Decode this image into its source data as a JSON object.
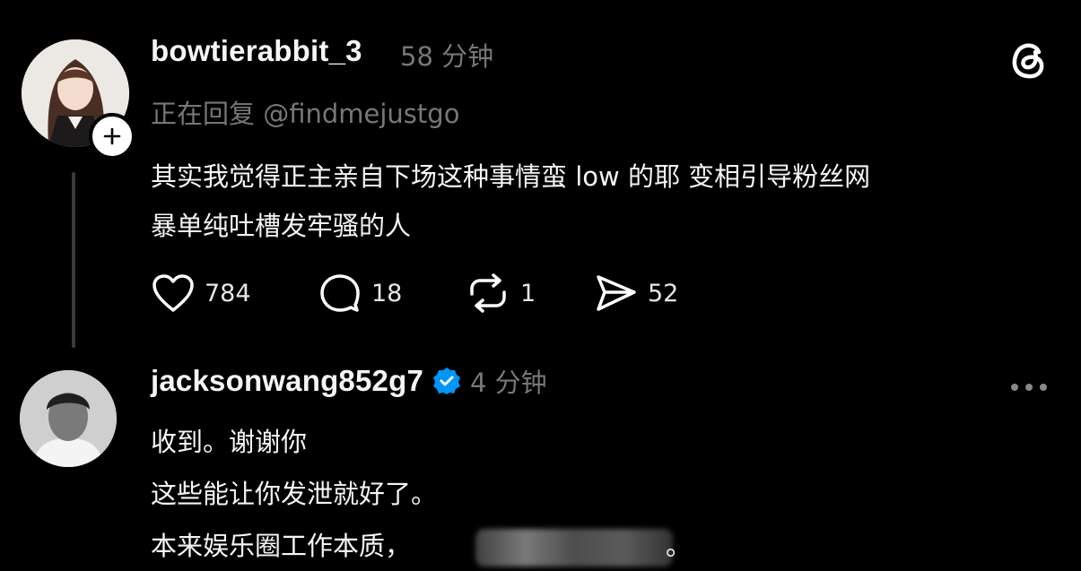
{
  "header": {
    "app_logo_icon": "threads-logo-icon"
  },
  "post": {
    "username": "bowtierabbit_3",
    "time": "58 分钟",
    "reply_to": "正在回复 @findmejustgo",
    "text_lines": [
      "其实我觉得正主亲自下场这种事情蛮 low 的耶 变相引导粉丝网",
      "暴单纯吐槽发牢骚的人"
    ],
    "actions": {
      "likes": "784",
      "comments": "18",
      "reposts": "1",
      "shares": "52"
    }
  },
  "reply": {
    "username": "jacksonwang852g7",
    "time": "4 分钟",
    "text_lines": [
      "收到。谢谢你",
      "这些能让你发泄就好了。",
      "本来娱乐圈工作本质，",
      "。"
    ]
  },
  "colors": {
    "background": "#000000",
    "text": "#f3f5f7",
    "muted": "#777777",
    "verified": "#0095f6"
  }
}
